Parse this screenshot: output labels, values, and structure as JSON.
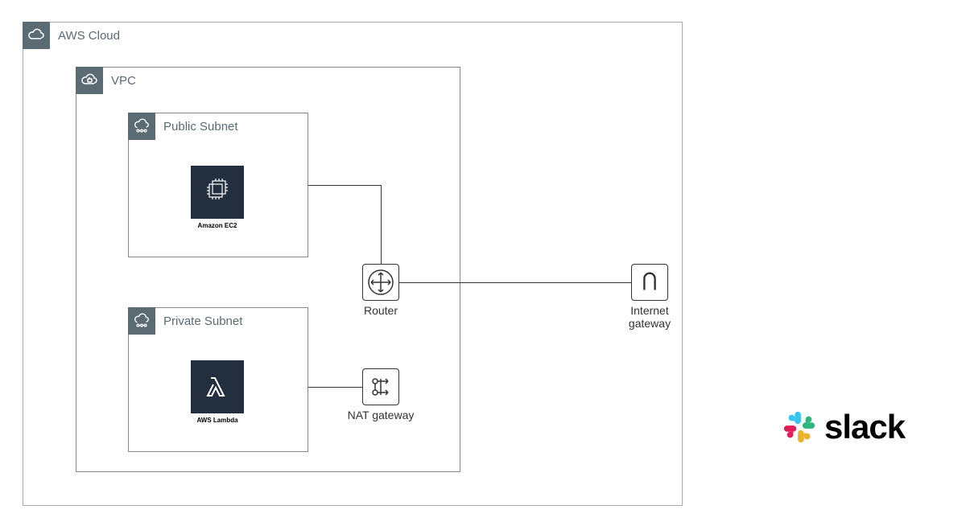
{
  "cloud": {
    "label": "AWS Cloud"
  },
  "vpc": {
    "label": "VPC"
  },
  "public_subnet": {
    "label": "Public Subnet"
  },
  "private_subnet": {
    "label": "Private Subnet"
  },
  "ec2": {
    "label": "Amazon EC2"
  },
  "lambda": {
    "label": "AWS Lambda"
  },
  "router": {
    "label": "Router"
  },
  "nat": {
    "label": "NAT gateway"
  },
  "igw": {
    "label": "Internet gateway"
  },
  "slack": {
    "label": "slack"
  }
}
